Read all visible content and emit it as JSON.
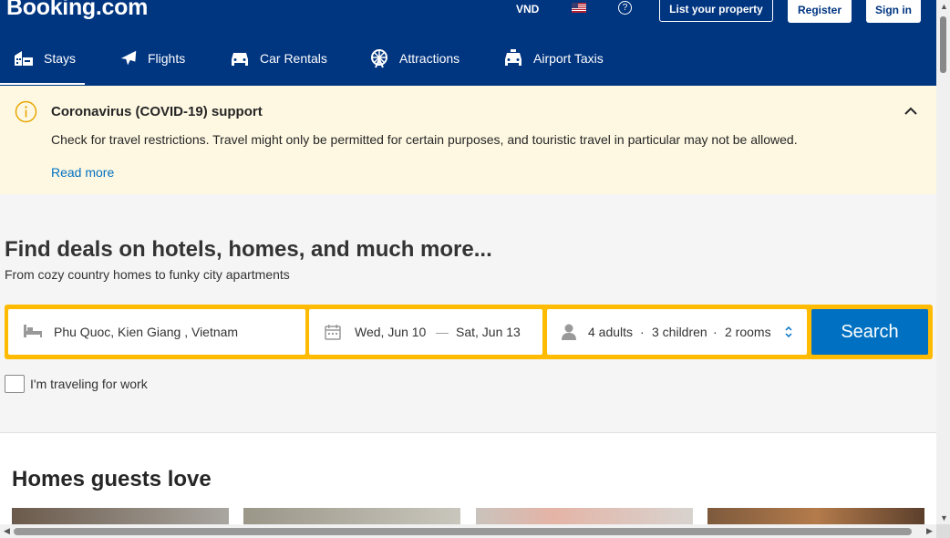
{
  "header": {
    "logo": "Booking.com",
    "currency": "VND",
    "flag": "flag-us-icon",
    "help": "?",
    "list_property": "List your property",
    "register": "Register",
    "sign_in": "Sign in"
  },
  "nav": {
    "items": [
      {
        "label": "Stays",
        "icon": "bed-building-icon"
      },
      {
        "label": "Flights",
        "icon": "airplane-icon"
      },
      {
        "label": "Car Rentals",
        "icon": "car-icon"
      },
      {
        "label": "Attractions",
        "icon": "ferris-wheel-icon"
      },
      {
        "label": "Airport Taxis",
        "icon": "taxi-icon"
      }
    ]
  },
  "alert": {
    "title": "Coronavirus (COVID-19) support",
    "body": "Check for travel restrictions. Travel might only be permitted for certain purposes, and touristic travel in particular may not be allowed.",
    "link": "Read more"
  },
  "hero": {
    "title": "Find deals on hotels, homes, and much more...",
    "subtitle": "From cozy country homes to funky city apartments"
  },
  "search": {
    "destination": "Phu Quoc, Kien Giang , Vietnam",
    "checkin": "Wed, Jun 10",
    "separator": "—",
    "checkout": "Sat, Jun 13",
    "adults": "4 adults",
    "dot": "·",
    "children": "3 children",
    "rooms": "2 rooms",
    "button": "Search",
    "work_label": "I'm traveling for work"
  },
  "homes": {
    "title": "Homes guests love"
  },
  "colors": {
    "brand": "#003580",
    "accent": "#febb02",
    "primary": "#0071c2",
    "alert_bg": "#fef8e2"
  }
}
